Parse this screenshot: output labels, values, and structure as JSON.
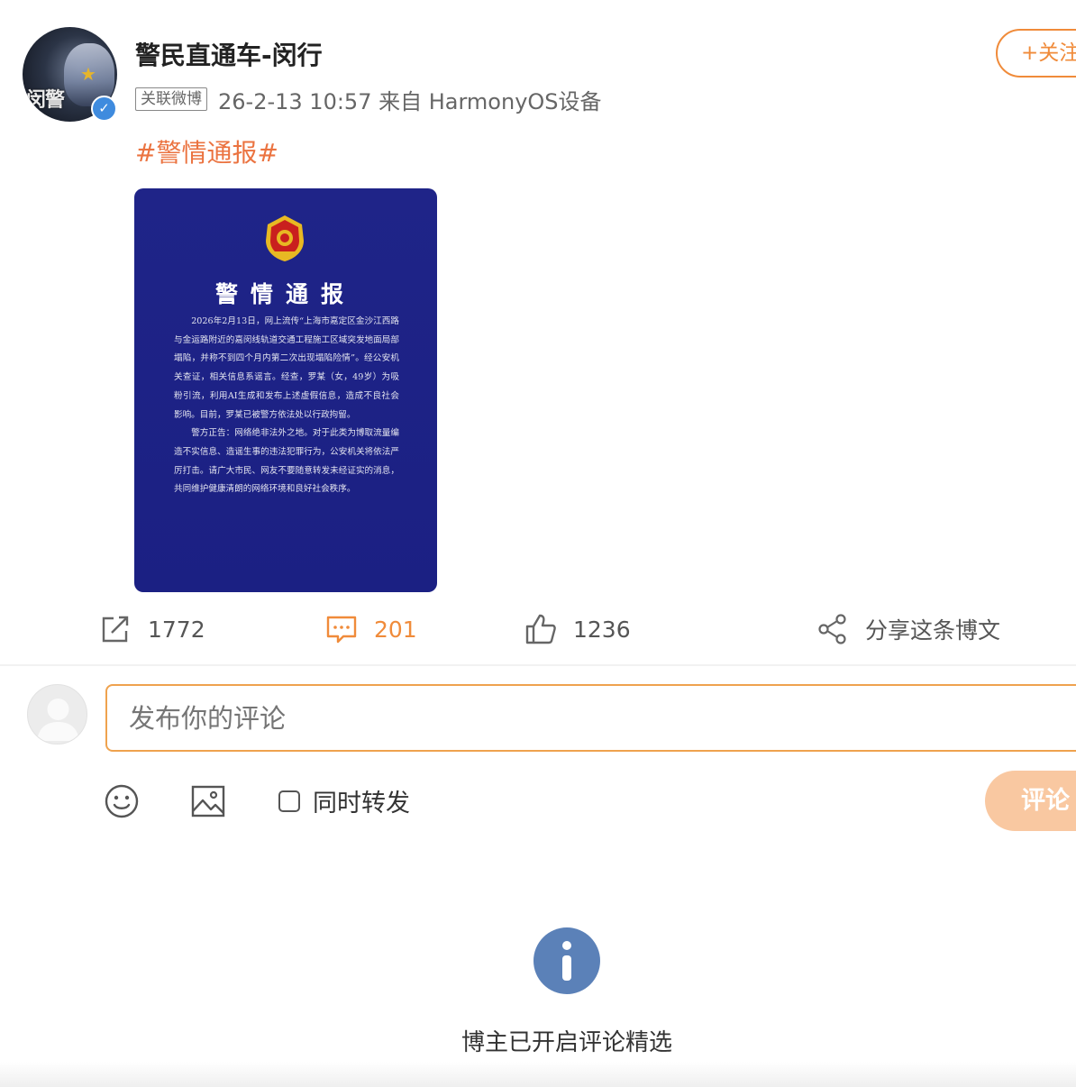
{
  "post": {
    "author": "警民直通车-闵行",
    "avatar_text": "闵警",
    "verified_mark": "✓",
    "follow_label": "+关注",
    "linked_tag": "关联微博",
    "meta": "26-2-13 10:57 来自 HarmonyOS设备",
    "hashtag": "#警情通报#",
    "notice": {
      "title": "警情通报",
      "paragraphs": [
        "2026年2月13日，网上流传“上海市嘉定区金沙江西路与金运路附近的嘉闵线轨道交通工程施工区域突发地面局部塌陷，并称不到四个月内第二次出现塌陷险情”。经公安机关查证，相关信息系谣言。经查，罗某（女，49岁）为吸粉引流，利用AI生成和发布上述虚假信息，造成不良社会影响。目前，罗某已被警方依法处以行政拘留。",
        "警方正告：网络绝非法外之地。对于此类为博取流量编造不实信息、造谣生事的违法犯罪行为，公安机关将依法严厉打击。请广大市民、网友不要随意转发未经证实的消息，共同维护健康清朗的网络环境和良好社会秩序。"
      ]
    }
  },
  "actions": {
    "repost_count": "1772",
    "comment_count": "201",
    "like_count": "1236",
    "share_label": "分享这条博文"
  },
  "comment_box": {
    "placeholder": "发布你的评论",
    "repost_label": "同时转发",
    "submit_label": "评论"
  },
  "info": {
    "message": "博主已开启评论精选"
  },
  "colors": {
    "accent": "#f08b3a",
    "hashtag": "#eb7340",
    "notice_bg": "#1e2381",
    "info_icon": "#5b81b8"
  },
  "icons": [
    "avatar",
    "verified-icon",
    "repost-icon",
    "comment-icon",
    "like-icon",
    "share-icon",
    "emoji-icon",
    "image-icon",
    "info-icon",
    "police-emblem-icon"
  ]
}
